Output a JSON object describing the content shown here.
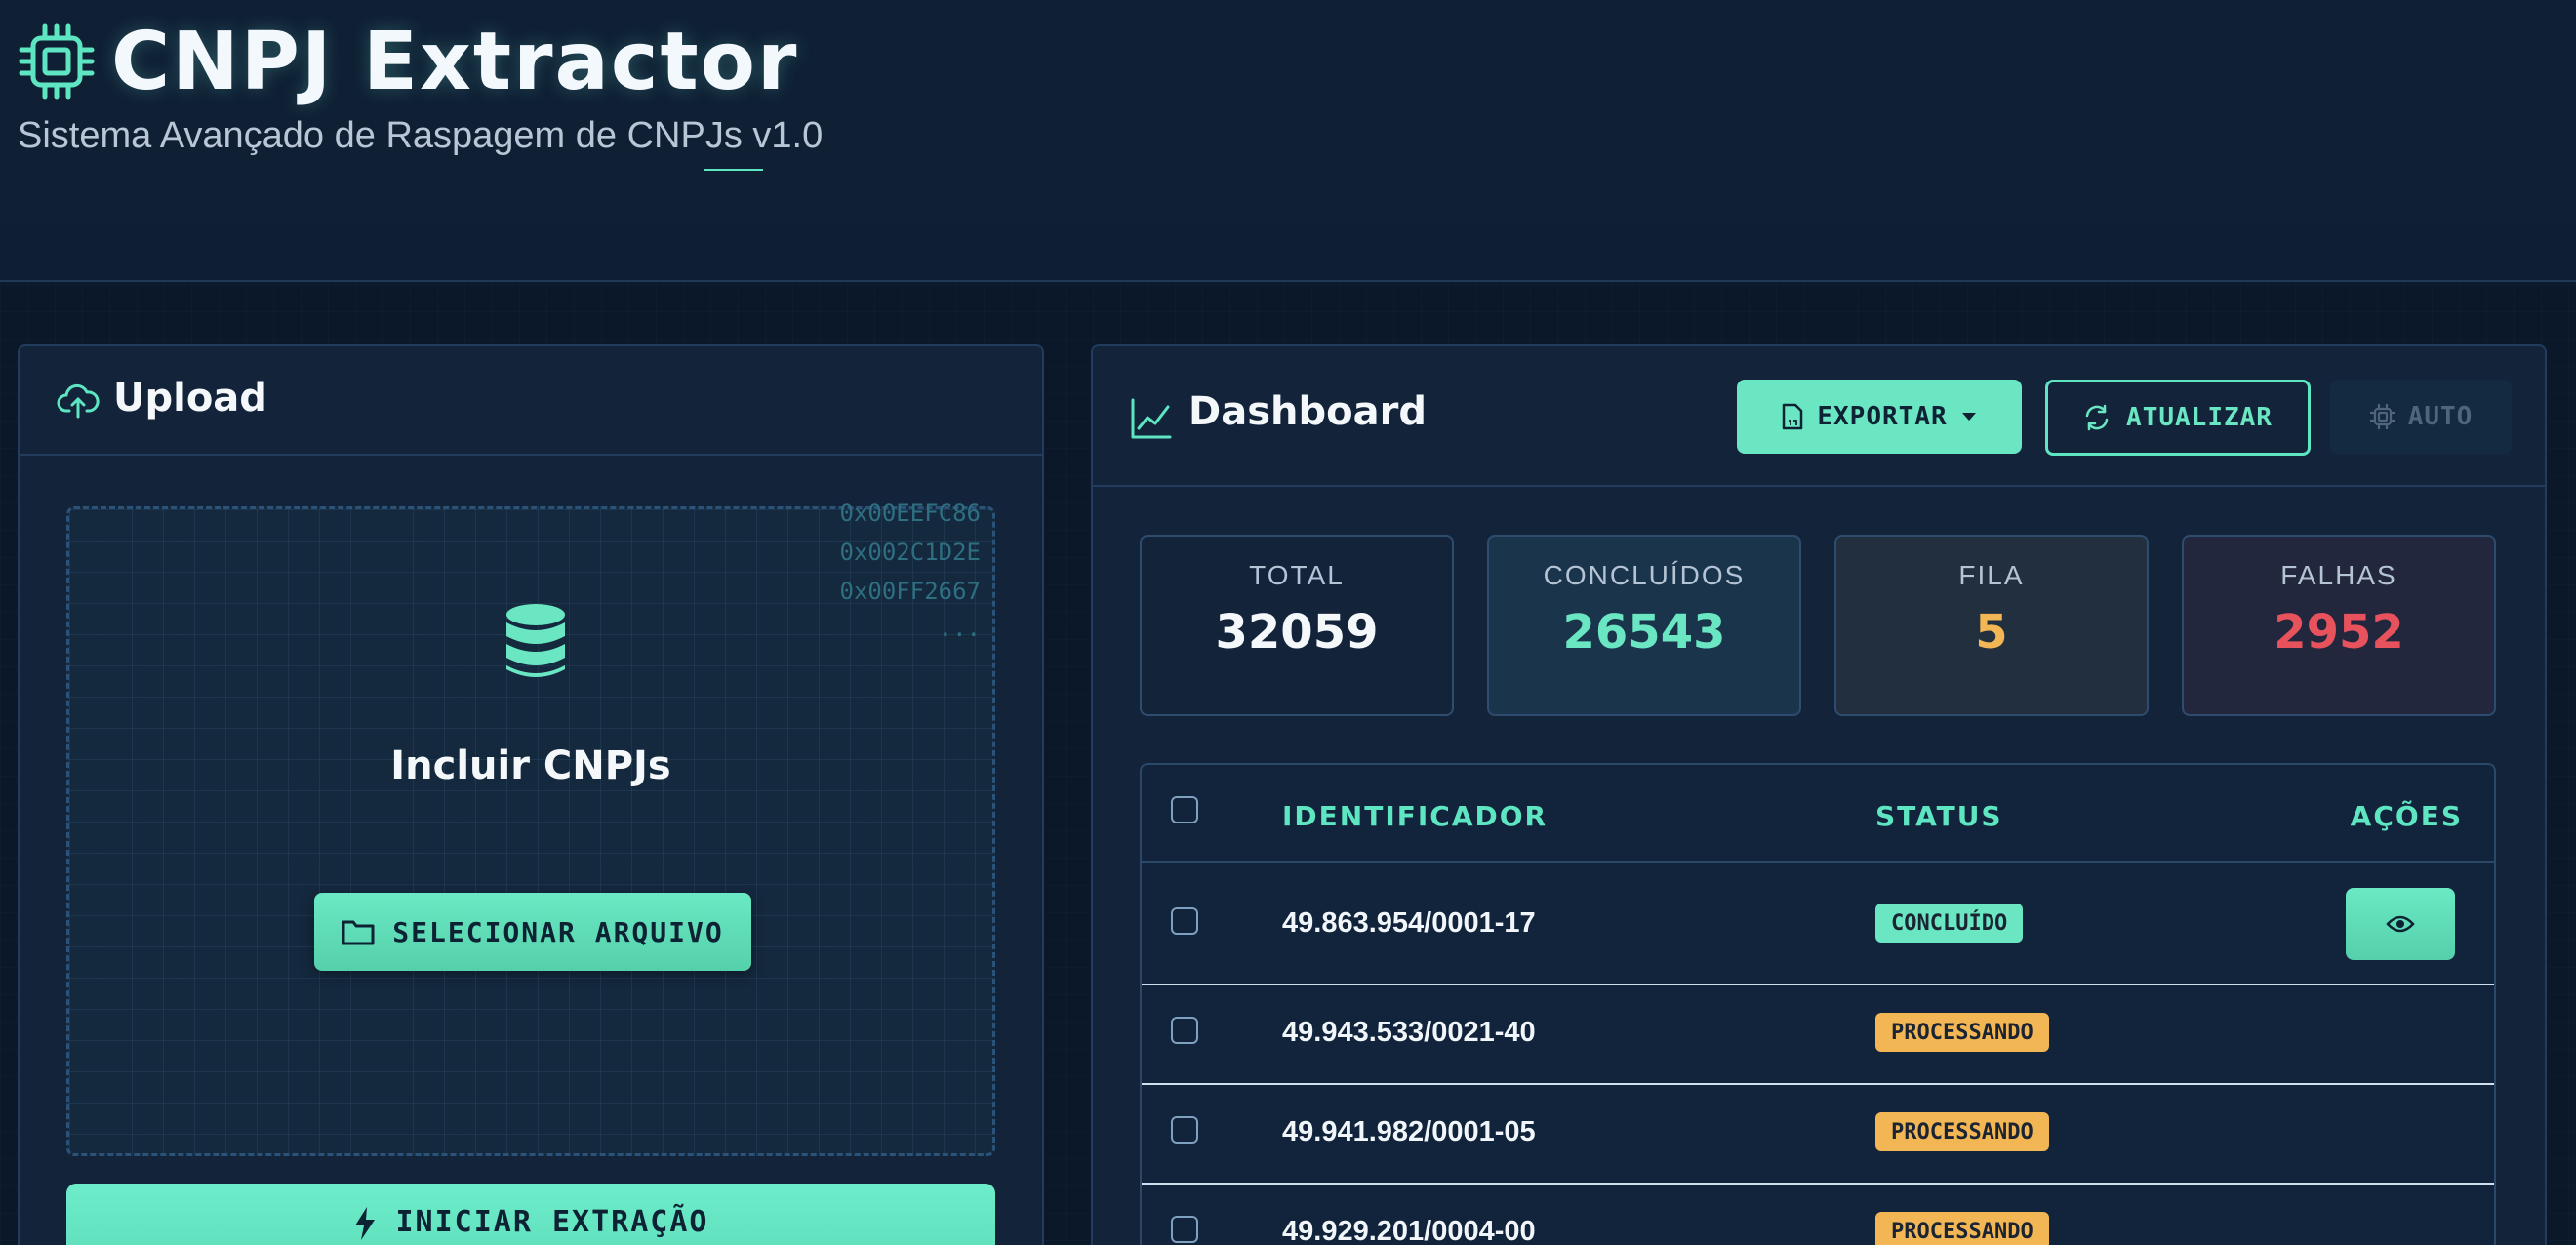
{
  "header": {
    "title": "CNPJ Extractor",
    "subtitle": "Sistema Avançado de Raspagem de CNPJs v1.0"
  },
  "upload": {
    "panel_title": "Upload",
    "hex_lines": [
      "0x00EEFC86",
      "0x002C1D2E",
      "0x00FF2667",
      "..."
    ],
    "drop_title": "Incluir CNPJs",
    "select_button": "SELECIONAR ARQUIVO",
    "start_button": "INICIAR EXTRAÇÃO"
  },
  "dashboard": {
    "panel_title": "Dashboard",
    "export_button": "EXPORTAR",
    "refresh_button": "ATUALIZAR",
    "auto_button": "AUTO",
    "stats": [
      {
        "label": "TOTAL",
        "value": "32059",
        "color": "#f4f8fb"
      },
      {
        "label": "CONCLUÍDOS",
        "value": "26543",
        "color": "#6ae7c2"
      },
      {
        "label": "FILA",
        "value": "5",
        "color": "#f2b655"
      },
      {
        "label": "FALHAS",
        "value": "2952",
        "color": "#e8525c"
      }
    ],
    "table": {
      "columns": [
        "IDENTIFICADOR",
        "STATUS",
        "AÇÕES"
      ],
      "rows": [
        {
          "cnpj": "49.863.954/0001-17",
          "status": "CONCLUÍDO",
          "status_color": "#6ae7c2"
        },
        {
          "cnpj": "49.943.533/0021-40",
          "status": "PROCESSANDO",
          "status_color": "#f2b655"
        },
        {
          "cnpj": "49.941.982/0001-05",
          "status": "PROCESSANDO",
          "status_color": "#f2b655"
        },
        {
          "cnpj": "49.929.201/0004-00",
          "status": "PROCESSANDO",
          "status_color": "#f2b655"
        }
      ]
    }
  },
  "colors": {
    "accent": "#6ae7c2",
    "background": "#0c1a2b",
    "panel": "#12233a",
    "warning": "#f2b655",
    "danger": "#e8525c"
  },
  "icons": {
    "logo": "chip-icon",
    "upload": "cloud-upload-icon",
    "dashboard": "line-chart-icon",
    "database": "database-icon",
    "folder": "folder-icon",
    "bolt": "bolt-icon",
    "file": "file-icon",
    "refresh": "refresh-icon",
    "auto": "chip-icon",
    "view": "eye-icon"
  }
}
